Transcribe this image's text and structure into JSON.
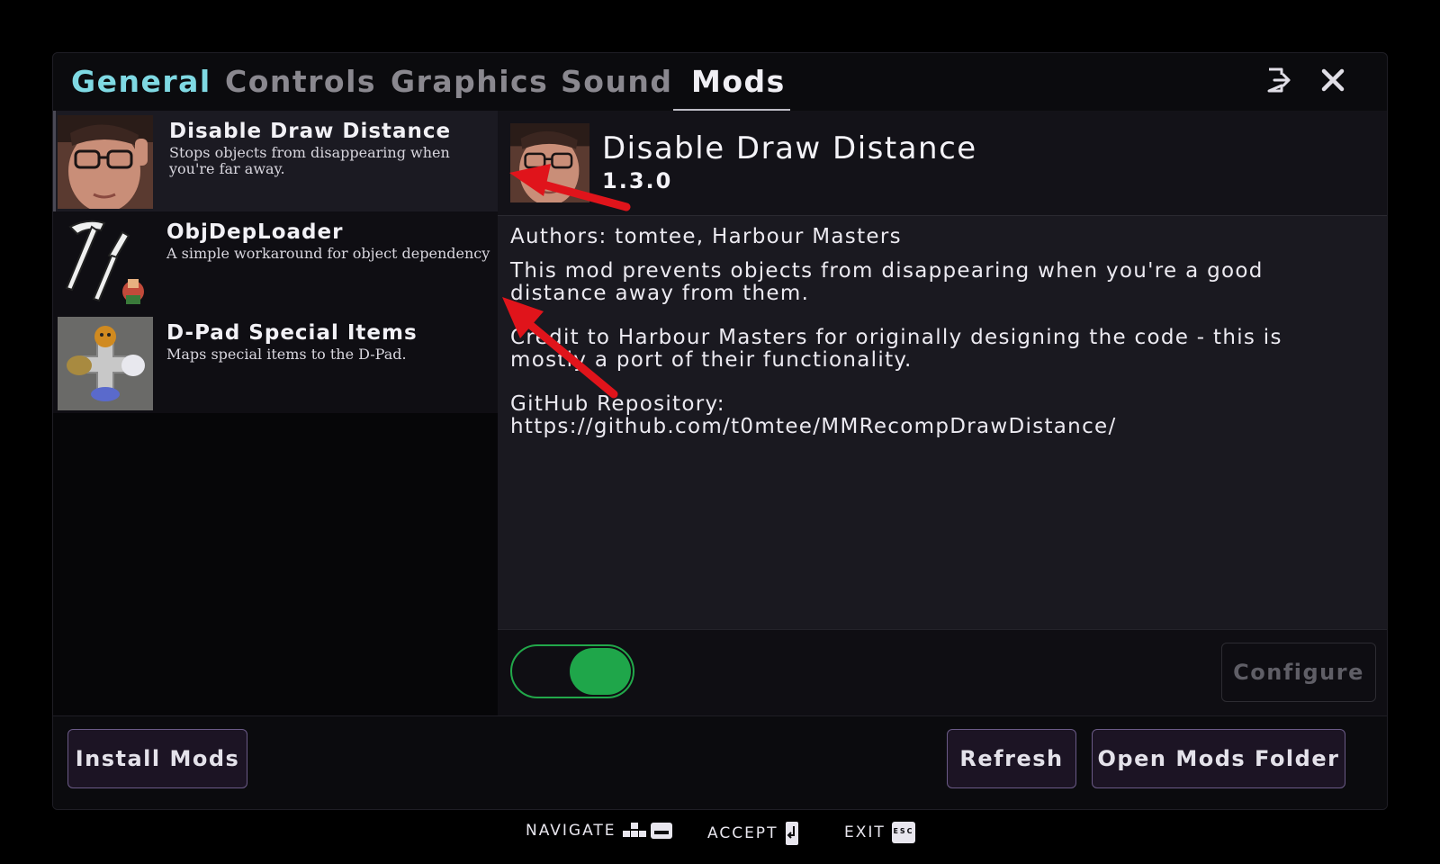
{
  "tabs": [
    {
      "label": "General"
    },
    {
      "label": "Controls"
    },
    {
      "label": "Graphics"
    },
    {
      "label": "Sound"
    },
    {
      "label": "Mods"
    }
  ],
  "active_tab": "Mods",
  "header_icons": [
    "exit-to-game-icon",
    "close-icon"
  ],
  "mods": [
    {
      "name": "Disable Draw Distance",
      "description": "Stops objects from disappearing when you're far away.",
      "thumbnail": "glasses-face-thumbnail",
      "selected": true
    },
    {
      "name": "ObjDepLoader",
      "description": "A simple workaround for object dependency",
      "thumbnail": "hammer-screwdriver-thumbnail",
      "selected": false
    },
    {
      "name": "D-Pad Special Items",
      "description": "Maps special items to the D-Pad.",
      "thumbnail": "dpad-masks-thumbnail",
      "selected": false
    }
  ],
  "details": {
    "title": "Disable Draw Distance",
    "version": "1.3.0",
    "authors": "Authors: tomtee, Harbour Masters",
    "paragraph1": "This mod prevents objects from disappearing when you're a good distance away from them.",
    "paragraph2": "Credit to Harbour Masters for originally designing the code - this is mostly a port of their functionality.",
    "github_label": "GitHub Repository:",
    "github_url": "https://github.com/t0mtee/MMRecompDrawDistance/"
  },
  "enabled": true,
  "configure_label": "Configure",
  "buttons": {
    "install": "Install Mods",
    "refresh": "Refresh",
    "open_folder": "Open Mods Folder"
  },
  "hints": [
    {
      "label": "NAVIGATE",
      "icon": "navigate-keys-icon"
    },
    {
      "label": "ACCEPT",
      "icon": "enter-key-icon"
    },
    {
      "label": "EXIT",
      "icon": "esc-key-icon"
    }
  ],
  "colors": {
    "general_tab": "#7fd9e3",
    "toggle_on": "#1fa64a",
    "button_border": "#6a5a86",
    "annotation_arrow": "#e0141b"
  }
}
